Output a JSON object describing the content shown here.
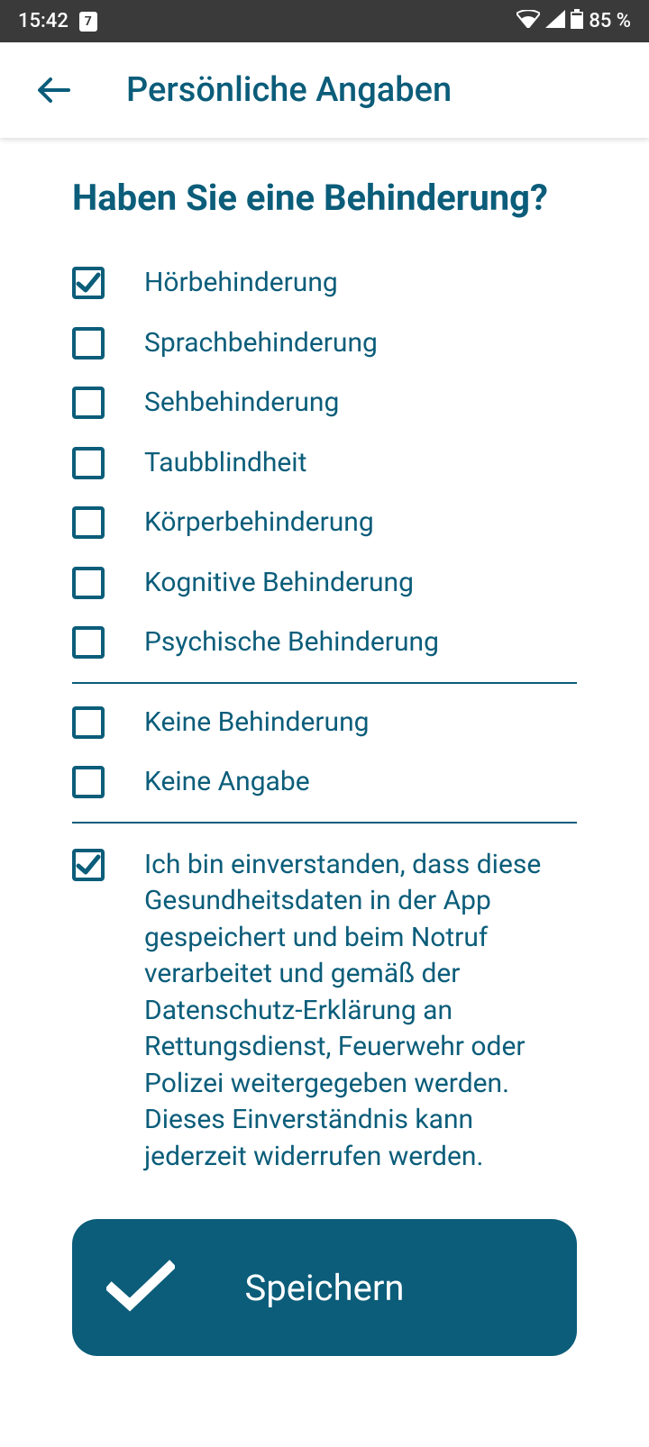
{
  "statusBar": {
    "time": "15:42",
    "calendarDay": "7",
    "battery": "85 %"
  },
  "appBar": {
    "title": "Persönliche Angaben"
  },
  "question": "Haben Sie eine Behinderung?",
  "options": [
    {
      "label": "Hörbehinderung",
      "checked": true
    },
    {
      "label": "Sprachbehinderung",
      "checked": false
    },
    {
      "label": "Sehbehinderung",
      "checked": false
    },
    {
      "label": "Taubblindheit",
      "checked": false
    },
    {
      "label": "Körperbehinderung",
      "checked": false
    },
    {
      "label": "Kognitive Behinderung",
      "checked": false
    },
    {
      "label": "Psychische Behinderung",
      "checked": false
    }
  ],
  "noneOptions": [
    {
      "label": "Keine Behinderung",
      "checked": false
    },
    {
      "label": "Keine Angabe",
      "checked": false
    }
  ],
  "consent": {
    "checked": true,
    "text": "Ich bin einverstanden, dass diese Gesundheitsdaten in der App gespeichert und beim Notruf verarbeitet und gemäß der Datenschutz-Erklärung an Rettungsdienst, Feuerwehr oder Polizei weitergegeben werden. Dieses Einverständnis kann jederzeit widerrufen werden."
  },
  "saveButton": "Speichern"
}
